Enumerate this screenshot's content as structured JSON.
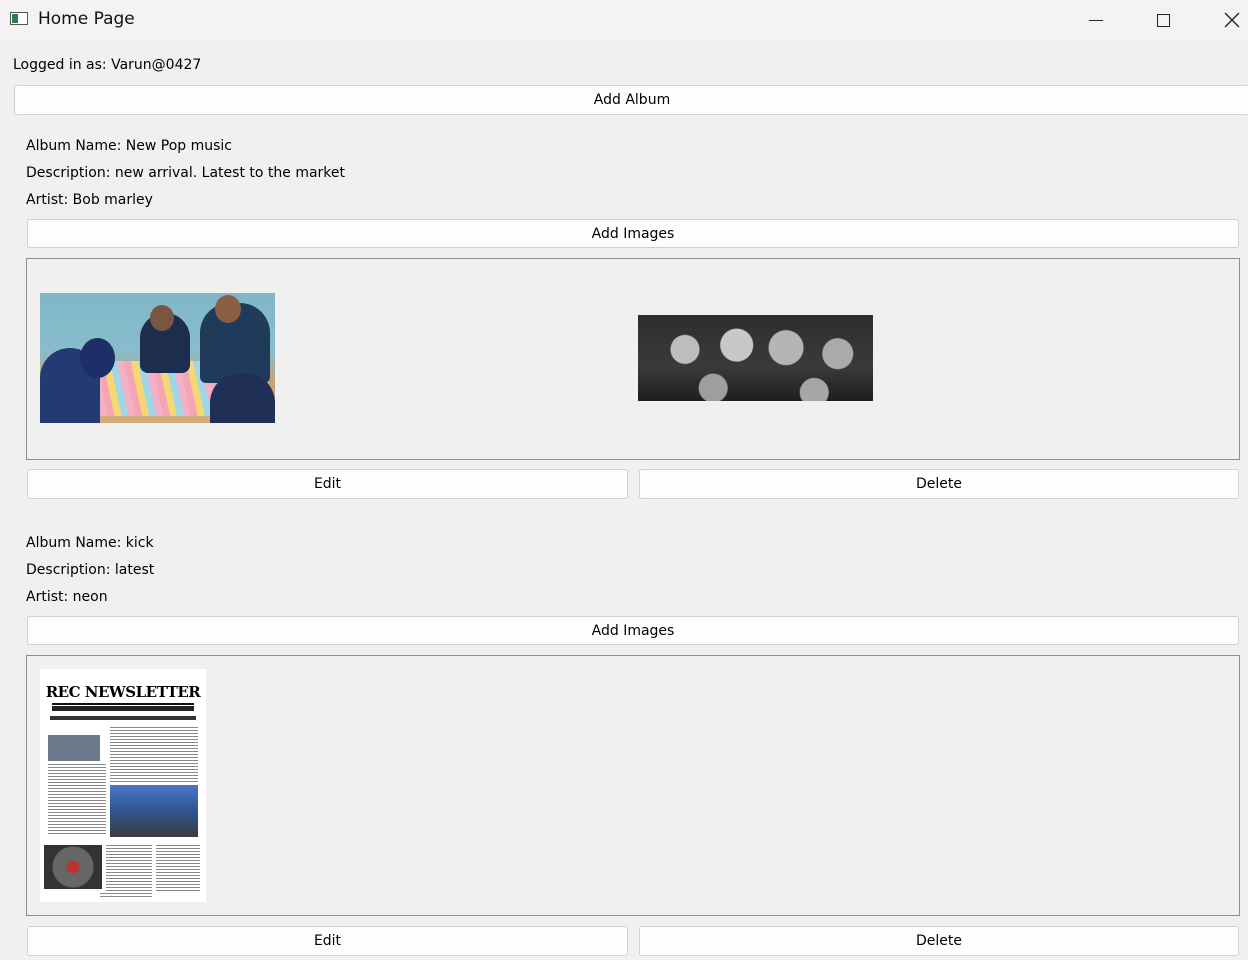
{
  "window": {
    "title": "Home Page"
  },
  "header": {
    "logged_in_text": "Logged in as: Varun@0427",
    "add_album_label": "Add Album"
  },
  "albums": [
    {
      "name_text": "Album Name: New Pop music",
      "description_text": "Description: new arrival. Latest to the market",
      "artist_text": "Artist: Bob marley",
      "add_images_label": "Add Images",
      "edit_label": "Edit",
      "delete_label": "Delete"
    },
    {
      "name_text": "Album Name: kick",
      "description_text": "Description: latest",
      "artist_text": "Artist: neon",
      "add_images_label": "Add Images",
      "edit_label": "Edit",
      "delete_label": "Delete",
      "newsletter": {
        "masthead": "REC NEWSLETTER"
      }
    }
  ],
  "icons": [
    "app-icon",
    "minimize-icon",
    "maximize-icon",
    "close-icon"
  ]
}
